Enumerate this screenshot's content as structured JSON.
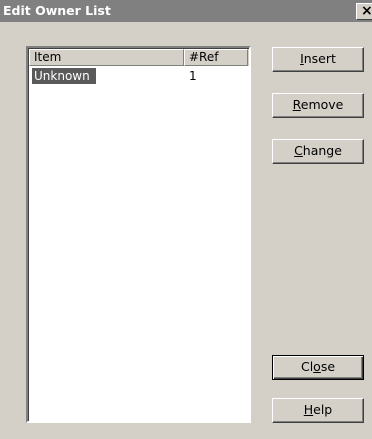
{
  "window": {
    "title": "Edit Owner List",
    "close_glyph": "×"
  },
  "list": {
    "columns": [
      {
        "label": "Item"
      },
      {
        "label": "#Ref"
      }
    ],
    "rows": [
      {
        "item": "Unknown",
        "ref": "1",
        "selected": true
      }
    ]
  },
  "buttons": {
    "insert": {
      "pre": "",
      "accel": "I",
      "post": "nsert"
    },
    "remove": {
      "pre": "",
      "accel": "R",
      "post": "emove"
    },
    "change": {
      "pre": "",
      "accel": "C",
      "post": "hange"
    },
    "close": {
      "pre": "Cl",
      "accel": "o",
      "post": "se"
    },
    "help": {
      "pre": "",
      "accel": "H",
      "post": "elp"
    }
  },
  "colors": {
    "dialog_bg": "#d4d0c8",
    "titlebar_bg": "#808080",
    "selection_bg": "#5a5a5a"
  },
  "icons": {
    "close": "close-icon"
  }
}
